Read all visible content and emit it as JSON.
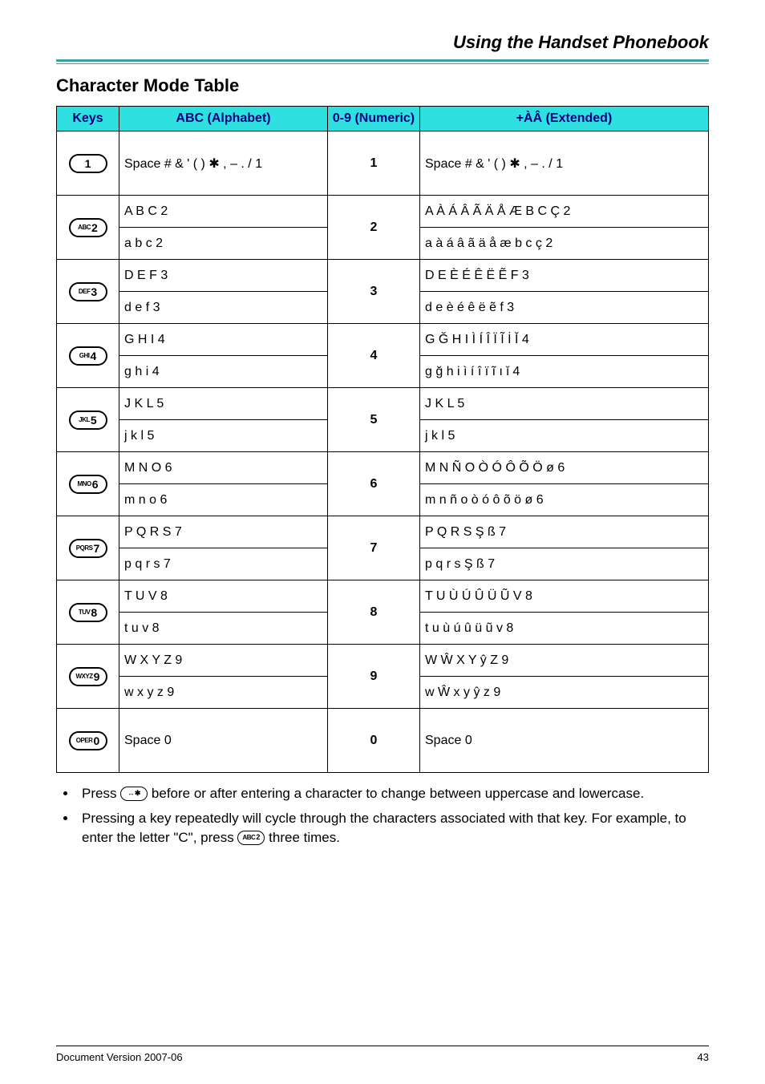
{
  "header": {
    "title": "Using the Handset Phonebook"
  },
  "section": {
    "title": "Character Mode Table"
  },
  "table": {
    "headers": {
      "keys": "Keys",
      "abc": "ABC (Alphabet)",
      "num": "0-9 (Numeric)",
      "ext": "+ÀÂ (Extended)"
    },
    "rows": [
      {
        "key": {
          "pre": "",
          "main": "1"
        },
        "abc_upper": "Space # & ' ( ) ✱ , – . / 1",
        "abc_lower": null,
        "num": "1",
        "ext_upper": "Space # & ' ( ) ✱ , – . / 1",
        "ext_lower": null
      },
      {
        "key": {
          "pre": "ABC",
          "main": "2"
        },
        "abc_upper": "A B C 2",
        "abc_lower": "a b c 2",
        "num": "2",
        "ext_upper": "A À Á Â Ã Ä Å Æ B C Ç 2",
        "ext_lower": "a à á â ã ä å æ b c ç 2"
      },
      {
        "key": {
          "pre": "DEF",
          "main": "3"
        },
        "abc_upper": "D E F 3",
        "abc_lower": "d e f 3",
        "num": "3",
        "ext_upper": "D E È É Ê Ë Ẽ F 3",
        "ext_lower": "d e è é ê ë ẽ f 3"
      },
      {
        "key": {
          "pre": "GHI",
          "main": "4"
        },
        "abc_upper": "G H I 4",
        "abc_lower": "g h i 4",
        "num": "4",
        "ext_upper": "G Ğ H I Ì Í Î Ï Ĩ İ Ǐ 4",
        "ext_lower": "g ğ h i ì í î ï ĩ ı ǐ 4"
      },
      {
        "key": {
          "pre": "JKL",
          "main": "5"
        },
        "abc_upper": "J K L 5",
        "abc_lower": "j k l 5",
        "num": "5",
        "ext_upper": "J K L 5",
        "ext_lower": "j k l 5"
      },
      {
        "key": {
          "pre": "MNO",
          "main": "6"
        },
        "abc_upper": "M N O 6",
        "abc_lower": "m n o 6",
        "num": "6",
        "ext_upper": "M N Ñ O Ò Ó Ô Õ Ö ø 6",
        "ext_lower": "m n ñ o ò ó ô õ ö ø 6"
      },
      {
        "key": {
          "pre": "PQRS",
          "main": "7"
        },
        "abc_upper": "P Q R S 7",
        "abc_lower": "p q r s 7",
        "num": "7",
        "ext_upper": "P Q R S Ş ß 7",
        "ext_lower": "p q r s Ş ß 7"
      },
      {
        "key": {
          "pre": "TUV",
          "main": "8"
        },
        "abc_upper": "T U V 8",
        "abc_lower": "t u v 8",
        "num": "8",
        "ext_upper": "T U Ù Ú Û Ü Ũ V 8",
        "ext_lower": "t u ù ú û ü ũ v 8"
      },
      {
        "key": {
          "pre": "WXYZ",
          "main": "9"
        },
        "abc_upper": "W X Y Z 9",
        "abc_lower": "w x y z 9",
        "num": "9",
        "ext_upper": "W Ŵ X Y ŷ Z 9",
        "ext_lower": "w Ŵ x y ŷ z 9"
      },
      {
        "key": {
          "pre": "OPER",
          "main": "0"
        },
        "abc_upper": "Space  0",
        "abc_lower": null,
        "num": "0",
        "ext_upper": "Space  0",
        "ext_lower": null
      }
    ]
  },
  "notes": {
    "n1a": "Press ",
    "n1_key": "↔✱",
    "n1b": " before or after entering a character to change between uppercase and lowercase.",
    "n2a": "Pressing a key repeatedly will cycle through the characters associated with that key. For example, to enter the letter \"C\", press ",
    "n2_key": "ABC2",
    "n2b": " three times."
  },
  "footer": {
    "left": "Document Version 2007-06",
    "right": "43"
  }
}
